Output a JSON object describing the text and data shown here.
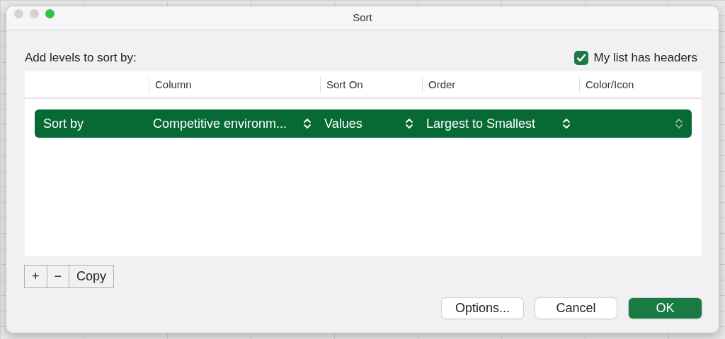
{
  "window": {
    "title": "Sort"
  },
  "label": "Add levels to sort by:",
  "headers_option": {
    "label": "My list has headers",
    "checked": true
  },
  "table": {
    "columns": [
      "Column",
      "Sort On",
      "Order",
      "Color/Icon"
    ],
    "rows": [
      {
        "label": "Sort by",
        "column": "Competitive environm...",
        "sort_on": "Values",
        "order": "Largest to Smallest",
        "selected": true
      }
    ]
  },
  "level_buttons": [
    "+",
    "−",
    "Copy"
  ],
  "buttons": [
    {
      "label": "Options...",
      "kind": "default"
    },
    {
      "label": "Cancel",
      "kind": "default"
    },
    {
      "label": "OK",
      "kind": "primary"
    }
  ]
}
